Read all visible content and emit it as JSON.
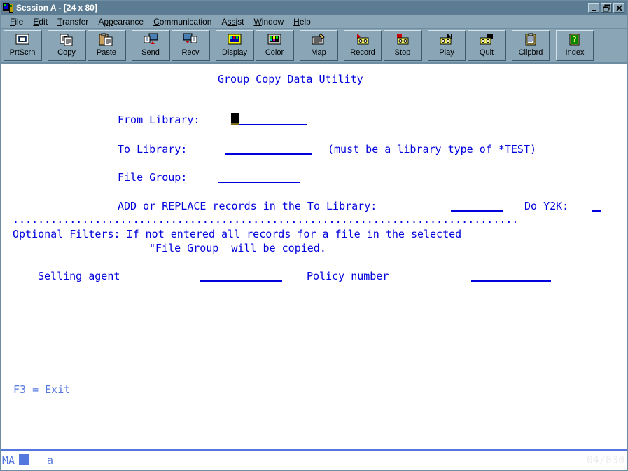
{
  "window": {
    "title": "Session A - [24 x 80]",
    "icon": "session-icon",
    "buttons": {
      "minimize": "_",
      "restore": "restore-icon",
      "close": "close-icon"
    }
  },
  "menubar": {
    "items": [
      {
        "label": "File",
        "accel": "F"
      },
      {
        "label": "Edit",
        "accel": "E"
      },
      {
        "label": "Transfer",
        "accel": "T"
      },
      {
        "label": "Appearance",
        "accel": "pp"
      },
      {
        "label": "Communication",
        "accel": "C"
      },
      {
        "label": "Assist",
        "accel": "ssi"
      },
      {
        "label": "Window",
        "accel": "W"
      },
      {
        "label": "Help",
        "accel": "H"
      }
    ]
  },
  "toolbar": {
    "groups": [
      {
        "buttons": [
          {
            "label": "PrtScrn",
            "icon": "print-screen-icon"
          }
        ]
      },
      {
        "buttons": [
          {
            "label": "Copy",
            "icon": "copy-icon"
          },
          {
            "label": "Paste",
            "icon": "paste-icon"
          }
        ]
      },
      {
        "buttons": [
          {
            "label": "Send",
            "icon": "send-file-icon"
          },
          {
            "label": "Recv",
            "icon": "receive-file-icon"
          }
        ]
      },
      {
        "buttons": [
          {
            "label": "Display",
            "icon": "display-setup-icon"
          },
          {
            "label": "Color",
            "icon": "color-setup-icon"
          }
        ]
      },
      {
        "buttons": [
          {
            "label": "Map",
            "icon": "keyboard-map-icon"
          }
        ]
      },
      {
        "buttons": [
          {
            "label": "Record",
            "icon": "record-icon"
          },
          {
            "label": "Stop",
            "icon": "stop-icon"
          }
        ]
      },
      {
        "buttons": [
          {
            "label": "Play",
            "icon": "play-icon"
          },
          {
            "label": "Quit",
            "icon": "quit-icon"
          }
        ]
      },
      {
        "buttons": [
          {
            "label": "Clipbrd",
            "icon": "clipboard-icon"
          }
        ]
      },
      {
        "buttons": [
          {
            "label": "Index",
            "icon": "index-help-icon"
          }
        ]
      }
    ]
  },
  "screen": {
    "title": "Group Copy Data Utility",
    "fields": {
      "from_library_label": "From Library:",
      "from_library_value": "",
      "to_library_label": "To Library:",
      "to_library_value": "",
      "to_library_note": "(must be a library type of *TEST)",
      "file_group_label": "File Group:",
      "file_group_value": "",
      "add_replace_label": "ADD or REPLACE records in the To Library:",
      "add_replace_value": "",
      "y2k_label": "Do Y2K:",
      "y2k_value": "_",
      "selling_agent_label": "Selling agent",
      "selling_agent_value": "",
      "policy_number_label": "Policy number",
      "policy_number_value": ""
    },
    "separator": "................................................................................",
    "filters_line1": "Optional Filters: If not entered all records for a file in the selected",
    "filters_line2": "\"File Group  will be copied.",
    "function_keys": "F3 = Exit"
  },
  "statusbar": {
    "mode_indicator": "MA",
    "input_indicator": "a",
    "cursor_position": "04/030"
  },
  "colors": {
    "terminal_blue": "#0000dd",
    "status_blue": "#5577e0",
    "window_chrome": "#8aa6b6",
    "titlebar": "#5b7c92",
    "cursor": "#000000"
  }
}
